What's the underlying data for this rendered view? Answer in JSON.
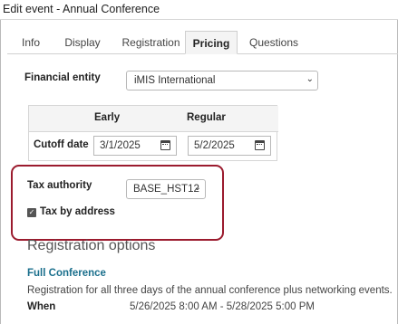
{
  "window": {
    "title": "Edit event - Annual Conference"
  },
  "tabs": [
    {
      "label": "Info"
    },
    {
      "label": "Display"
    },
    {
      "label": "Registration"
    },
    {
      "label": "Pricing"
    },
    {
      "label": "Questions"
    }
  ],
  "active_tab": "Pricing",
  "financial_entity": {
    "label": "Financial entity",
    "value": "iMIS International"
  },
  "pricing_grid": {
    "col_early": "Early",
    "col_regular": "Regular",
    "row_label": "Cutoff date",
    "early_date": "3/1/2025",
    "regular_date": "5/2/2025"
  },
  "tax": {
    "authority_label": "Tax authority",
    "authority_value": "BASE_HST12",
    "by_address_label": "Tax by address",
    "by_address_checked": true
  },
  "highlight_color": "#9b1b2e",
  "registration_options": {
    "title": "Registration options",
    "item_name": "Full Conference",
    "item_description": "Registration for all three days of the annual conference plus networking events.",
    "when_label": "When",
    "when_value": "5/26/2025 8:00 AM - 5/28/2025 5:00 PM"
  }
}
